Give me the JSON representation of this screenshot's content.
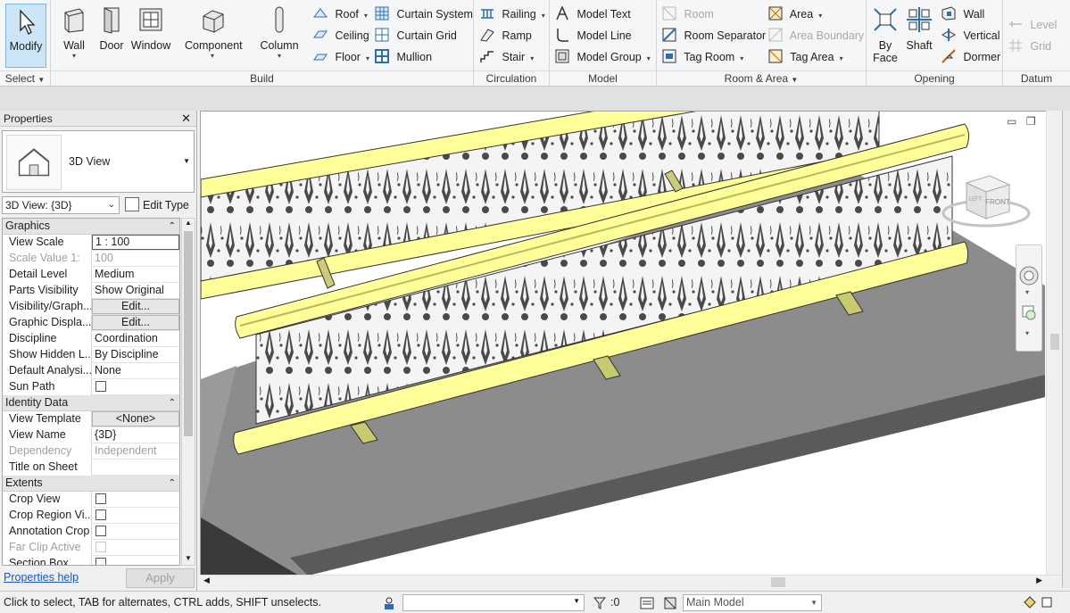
{
  "ribbon": {
    "select": {
      "modify_label": "Modify",
      "panel_label": "Select"
    },
    "build": {
      "panel_label": "Build",
      "big": [
        "Wall",
        "Door",
        "Window",
        "Component",
        "Column"
      ],
      "small": [
        {
          "label": "Roof",
          "dd": "▾"
        },
        {
          "label": "Ceiling"
        },
        {
          "label": "Floor",
          "dd": "▾"
        },
        {
          "label": "Curtain System"
        },
        {
          "label": "Curtain Grid"
        },
        {
          "label": "Mullion"
        }
      ]
    },
    "circulation": {
      "panel_label": "Circulation",
      "items": [
        {
          "label": "Railing",
          "dd": "▾"
        },
        {
          "label": "Ramp"
        },
        {
          "label": "Stair",
          "dd": "▾"
        }
      ]
    },
    "model": {
      "panel_label": "Model",
      "items": [
        {
          "label": "Model Text"
        },
        {
          "label": "Model Line"
        },
        {
          "label": "Model Group",
          "dd": "▾"
        }
      ]
    },
    "room_area": {
      "panel_label": "Room & Area",
      "items": [
        {
          "label": "Room",
          "disabled": true
        },
        {
          "label": "Room Separator"
        },
        {
          "label": "Tag Room",
          "dd": "▾"
        },
        {
          "label": "Area",
          "dd": "▾"
        },
        {
          "label": "Area Boundary",
          "disabled": true
        },
        {
          "label": "Tag Area",
          "dd": "▾"
        }
      ]
    },
    "opening": {
      "panel_label": "Opening",
      "by_face": "By Face",
      "by_face_1": "By",
      "by_face_2": "Face",
      "shaft": "Shaft",
      "items": [
        {
          "label": "Wall"
        },
        {
          "label": "Vertical"
        },
        {
          "label": "Dormer"
        }
      ]
    },
    "datum": {
      "panel_label": "Datum",
      "items": [
        {
          "label": "Level"
        },
        {
          "label": "Grid"
        }
      ]
    }
  },
  "properties": {
    "title": "Properties",
    "type_name": "3D View",
    "view_filter": "3D View: {3D}",
    "edit_type": "Edit Type",
    "groups": [
      {
        "name": "Graphics",
        "rows": [
          {
            "name": "View Scale",
            "value": "1 : 100",
            "style": "boxed"
          },
          {
            "name": "Scale Value    1:",
            "value": "100",
            "disabled": true
          },
          {
            "name": "Detail Level",
            "value": "Medium"
          },
          {
            "name": "Parts Visibility",
            "value": "Show Original"
          },
          {
            "name": "Visibility/Graph...",
            "value": "Edit...",
            "style": "btn"
          },
          {
            "name": "Graphic Displa...",
            "value": "Edit...",
            "style": "btn"
          },
          {
            "name": "Discipline",
            "value": "Coordination"
          },
          {
            "name": "Show Hidden L...",
            "value": "By Discipline"
          },
          {
            "name": "Default Analysi...",
            "value": "None"
          },
          {
            "name": "Sun Path",
            "value": "",
            "check": true
          }
        ]
      },
      {
        "name": "Identity Data",
        "rows": [
          {
            "name": "View Template",
            "value": "<None>",
            "style": "btn"
          },
          {
            "name": "View Name",
            "value": "{3D}"
          },
          {
            "name": "Dependency",
            "value": "Independent",
            "disabled": true
          },
          {
            "name": "Title on Sheet",
            "value": ""
          }
        ]
      },
      {
        "name": "Extents",
        "rows": [
          {
            "name": "Crop View",
            "value": "",
            "check": true
          },
          {
            "name": "Crop Region Vi...",
            "value": "",
            "check": true
          },
          {
            "name": "Annotation Crop",
            "value": "",
            "check": true
          },
          {
            "name": "Far Clip Active",
            "value": "",
            "check": true,
            "disabled": true
          },
          {
            "name": "Section Box",
            "value": "",
            "check": true
          }
        ]
      }
    ],
    "help_link": "Properties help",
    "apply_label": "Apply"
  },
  "viewport": {
    "view_cube_face": "FRONT",
    "view_cube_side": "LEFT",
    "window_controls": [
      "▭",
      "❐",
      "✕"
    ]
  },
  "status_bar": {
    "text": "Click to select, TAB for alternates, CTRL adds, SHIFT unselects.",
    "selection_count": ":0",
    "model_name": "Main Model",
    "workset_value": ""
  },
  "colors": {
    "rail_yellow": "#ffff99",
    "deck_gray": "#8c8c8c",
    "accent_blue": "#2a6ebb"
  }
}
